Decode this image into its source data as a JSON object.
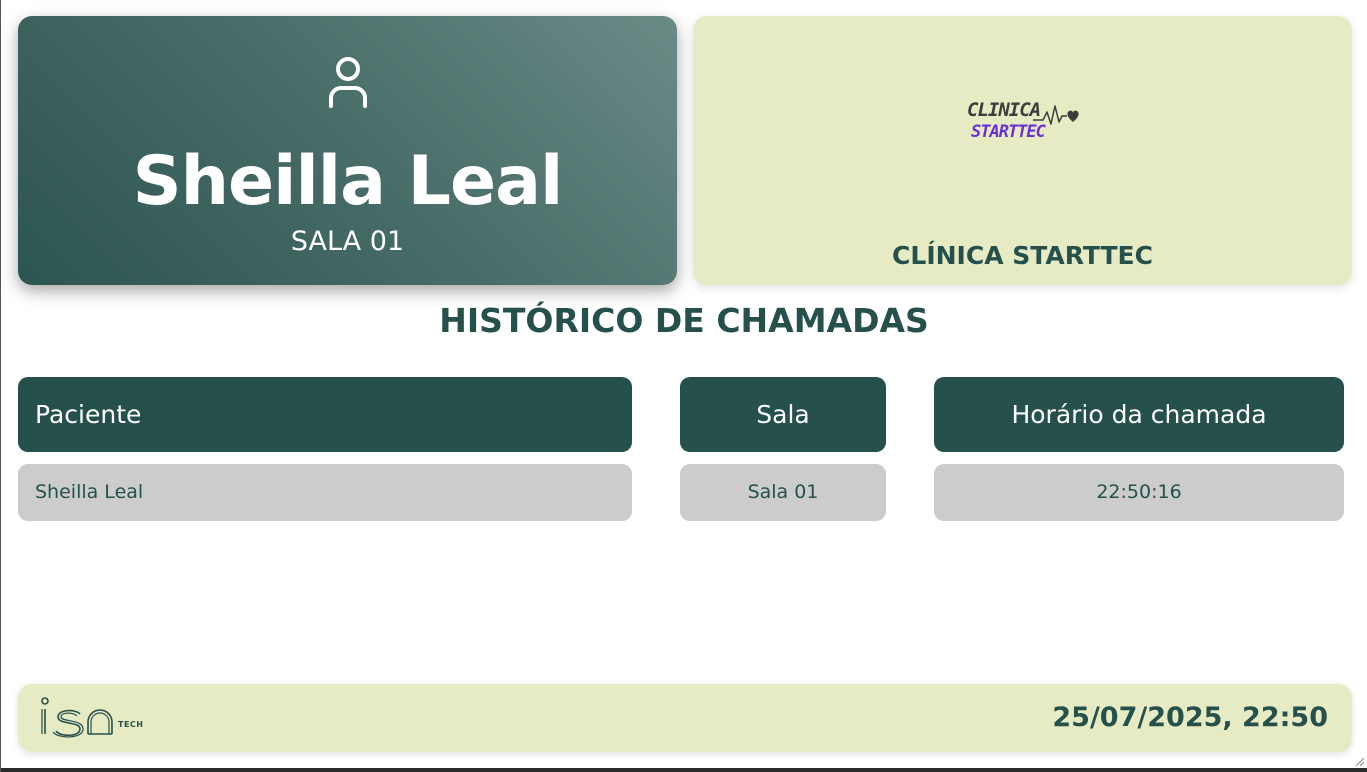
{
  "current_call": {
    "patient_name": "Sheilla Leal",
    "room": "SALA 01",
    "icon": "person-icon"
  },
  "clinic": {
    "logo_line1": "CLINICA",
    "logo_line2": "STARTTEC",
    "name": "CLÍNICA STARTTEC"
  },
  "history": {
    "title": "HISTÓRICO DE CHAMADAS",
    "columns": {
      "patient": "Paciente",
      "room": "Sala",
      "time": "Horário da chamada"
    },
    "rows": [
      {
        "patient": "Sheilla Leal",
        "room": "Sala 01",
        "time": "22:50:16"
      }
    ]
  },
  "footer": {
    "logo_tech": "TECH",
    "datetime": "25/07/2025, 22:50"
  },
  "colors": {
    "primary": "#25504b",
    "accent_bg": "#e6ebc3",
    "cell_bg": "#cccccc",
    "logo_purple": "#6b2fd6"
  }
}
